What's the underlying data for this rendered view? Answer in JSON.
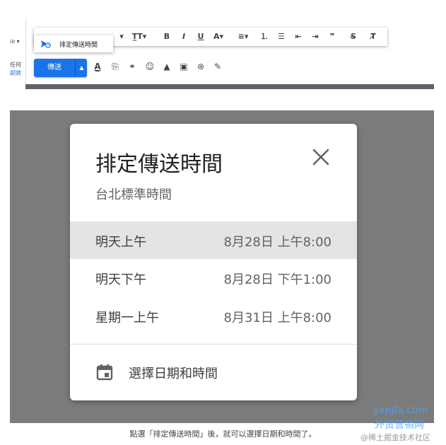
{
  "top_panel": {
    "left_edge": {
      "frag1": "io ▾",
      "frag2": "任何",
      "frag3": "即將"
    },
    "schedule_popup": {
      "label": "排定傳送時間",
      "icon": "schedule-send-icon"
    },
    "send_button": {
      "label": "傳送",
      "arrow_icon": "arrow-up-icon"
    },
    "toolbar_items": [
      {
        "name": "font-size-dropdown-icon",
        "glyph": "▾"
      },
      {
        "name": "text-size-icon",
        "glyph": "T̲T▾"
      },
      {
        "name": "bold-icon",
        "glyph": "B"
      },
      {
        "name": "italic-icon",
        "glyph": "I"
      },
      {
        "name": "underline-icon",
        "glyph": "U"
      },
      {
        "name": "text-color-icon",
        "glyph": "A▾"
      },
      {
        "name": "align-icon",
        "glyph": "≡▾"
      },
      {
        "name": "numbered-list-icon",
        "glyph": "⒈"
      },
      {
        "name": "bulleted-list-icon",
        "glyph": "☰"
      },
      {
        "name": "indent-less-icon",
        "glyph": "⇤"
      },
      {
        "name": "indent-more-icon",
        "glyph": "⇥"
      },
      {
        "name": "quote-icon",
        "glyph": "❞"
      },
      {
        "name": "strikethrough-icon",
        "glyph": "S̶"
      },
      {
        "name": "clear-formatting-icon",
        "glyph": "T̸"
      }
    ],
    "bottom_icons": [
      {
        "name": "formatting-options-icon",
        "glyph": "A̲"
      },
      {
        "name": "attach-file-icon",
        "glyph": "⎘"
      },
      {
        "name": "insert-link-icon",
        "glyph": "⚭"
      },
      {
        "name": "insert-emoji-icon",
        "glyph": "☺"
      },
      {
        "name": "google-drive-icon",
        "glyph": "▲"
      },
      {
        "name": "insert-photo-icon",
        "glyph": "▣"
      },
      {
        "name": "confidential-mode-icon",
        "glyph": "⊛"
      },
      {
        "name": "signature-icon",
        "glyph": "✎"
      }
    ]
  },
  "dialog": {
    "title": "排定傳送時間",
    "subtitle": "台北標準時間",
    "close_icon": "close-icon",
    "options": [
      {
        "label": "明天上午",
        "value": "8月28日 上午8:00",
        "highlighted": true
      },
      {
        "label": "明天下午",
        "value": "8月28日 下午1:00",
        "highlighted": false
      },
      {
        "label": "星期一上午",
        "value": "8月31日 上午8:00",
        "highlighted": false
      }
    ],
    "pick_label": "選擇日期和時間",
    "pick_icon": "calendar-icon"
  },
  "caption": "點選「排定傳送時間」後，就可以選擇日期和時間了。",
  "watermark": {
    "line1": "yxpjfa.com",
    "line2": "外贸营销网",
    "line3": "@稀土掘金技术社区"
  },
  "colors": {
    "accent": "#1a73e8",
    "overlay": "#7b7b7b",
    "highlight": "#e4e4e4"
  }
}
